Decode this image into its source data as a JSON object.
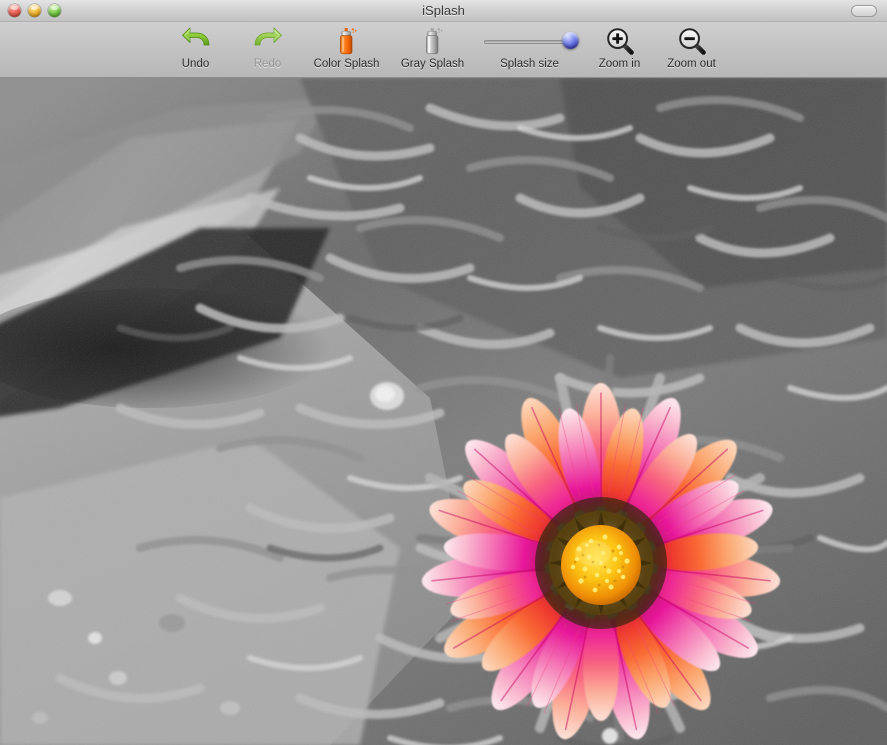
{
  "window": {
    "title": "iSplash",
    "controls": {
      "close": "close-button",
      "minimize": "minimize-button",
      "zoom": "zoom-button",
      "toolbar_toggle": "toolbar-toggle-button"
    }
  },
  "toolbar": {
    "items": [
      {
        "label": "Undo",
        "icon": "undo-arrow-icon",
        "enabled": true
      },
      {
        "label": "Redo",
        "icon": "redo-arrow-icon",
        "enabled": false
      },
      {
        "label": "Color Splash",
        "icon": "orange-spray-can-icon",
        "enabled": true
      },
      {
        "label": "Gray Splash",
        "icon": "gray-spray-can-icon",
        "enabled": true
      },
      {
        "label": "Splash size",
        "icon": "size-slider",
        "enabled": true
      },
      {
        "label": "Zoom in",
        "icon": "magnifier-plus-icon",
        "enabled": true
      },
      {
        "label": "Zoom out",
        "icon": "magnifier-minus-icon",
        "enabled": true
      }
    ],
    "slider": {
      "value": 88,
      "min": 0,
      "max": 100
    }
  },
  "image": {
    "description": "Gazania flower in color over a desaturated grayscale garden background",
    "subject": "gazania-flower",
    "colors": {
      "petal_magenta": "#e8189a",
      "petal_pink": "#f26fb4",
      "petal_coral": "#f4663a",
      "petal_pale": "#f9c9cd",
      "center_gold": "#f0a800",
      "center_yellow": "#ffd92e",
      "center_ring": "#4a3a10",
      "bg_light": "#c8c8c8",
      "bg_mid": "#8a8a8a",
      "bg_dark": "#3a3a3a"
    }
  }
}
